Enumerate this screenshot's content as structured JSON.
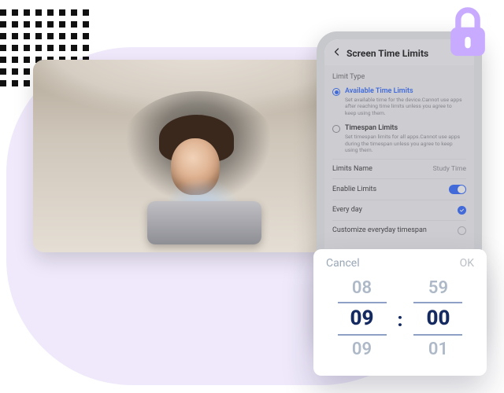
{
  "colors": {
    "accent": "#2b66ff",
    "lilac_bg": "#efe9fb",
    "lock": "#c8abff"
  },
  "decor": {
    "lock_icon": "lock-icon",
    "dots_pattern": "dot-grid"
  },
  "photo": {
    "alt": "Child under a blanket looking at a tablet",
    "tablet_icon": "tablet-device"
  },
  "phone": {
    "header": {
      "back_icon": "arrow-left-icon",
      "title": "Screen Time Limits"
    },
    "limit_type": {
      "section_label": "Limit Type",
      "available": {
        "label": "Available Time Limits",
        "desc": "Set available time for the device.Cannot use apps after reaching time limits unless you agree to keep using them.",
        "selected": true
      },
      "timespan": {
        "label": "Timespan Limits",
        "desc": "Set timespan limits for all apps.Cannot use apps during the timespan unless you agree to keep using them.",
        "selected": false
      }
    },
    "limits_name": {
      "label": "Limits Name",
      "value": "Study Time"
    },
    "enable_limits": {
      "label": "Enablie Limits",
      "on": true
    },
    "every_day": {
      "label": "Every day",
      "checked": true
    },
    "customize": {
      "label": "Customize everyday timespan",
      "checked": false
    }
  },
  "picker": {
    "cancel": "Cancel",
    "ok": "OK",
    "hours": {
      "prev": "08",
      "sel": "09",
      "next": "09"
    },
    "minutes": {
      "prev": "59",
      "sel": "00",
      "next": "01"
    },
    "separator": ":"
  }
}
